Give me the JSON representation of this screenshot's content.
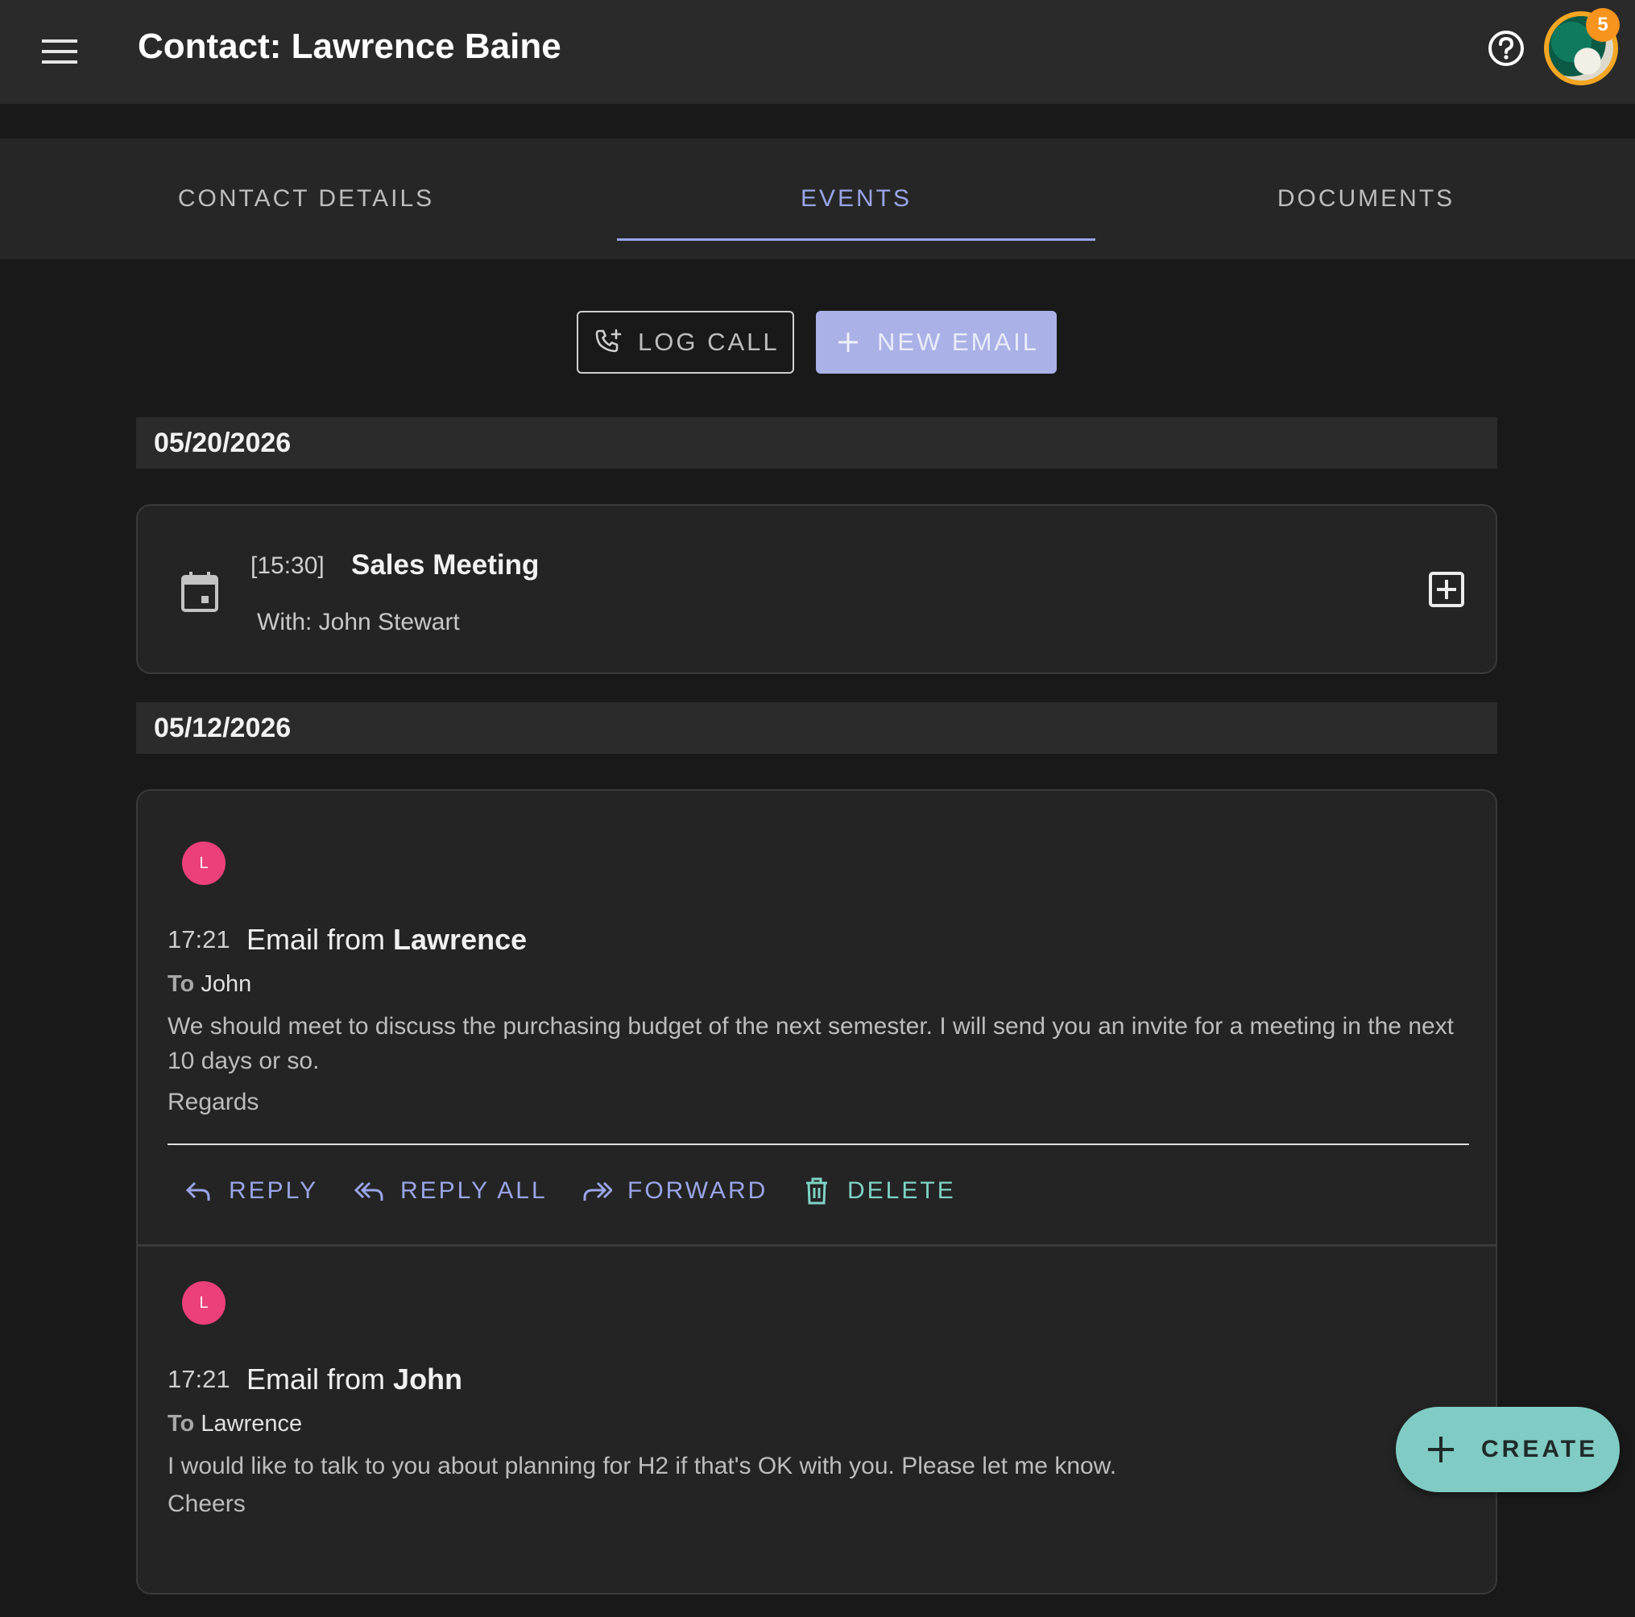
{
  "appbar": {
    "title": "Contact: Lawrence Baine",
    "notification_count": "5"
  },
  "tabs": [
    {
      "label": "CONTACT DETAILS"
    },
    {
      "label": "EVENTS"
    },
    {
      "label": "DOCUMENTS"
    }
  ],
  "actions": {
    "log_call": "LOG CALL",
    "new_email": "NEW EMAIL"
  },
  "groups": [
    {
      "date": "05/20/2026",
      "meeting": {
        "time": "[15:30]",
        "title": "Sales Meeting",
        "with": "With: John Stewart"
      }
    },
    {
      "date": "05/12/2026",
      "emails": [
        {
          "avatar_initial": "L",
          "time": "17:21",
          "subject_prefix": "Email from",
          "subject_name": "Lawrence",
          "to_label": "To",
          "to_name": "John",
          "body": "We should meet to discuss the purchasing budget of the next semester. I will send you an invite for a meeting in the next 10 days or so.",
          "sign": "Regards",
          "actions": [
            "REPLY",
            "REPLY ALL",
            "FORWARD",
            "DELETE"
          ]
        },
        {
          "avatar_initial": "L",
          "time": "17:21",
          "subject_prefix": "Email from",
          "subject_name": "John",
          "to_label": "To",
          "to_name": "Lawrence",
          "body": "I would like to talk to you about planning for H2 if that's OK with you. Please let me know.",
          "sign": "Cheers"
        }
      ]
    }
  ],
  "fab": {
    "label": "CREATE"
  },
  "colors": {
    "accent": "#9aa5e8",
    "teal": "#80cbc4",
    "avatar_pink": "#ec407a",
    "badge_orange": "#f7941d"
  }
}
